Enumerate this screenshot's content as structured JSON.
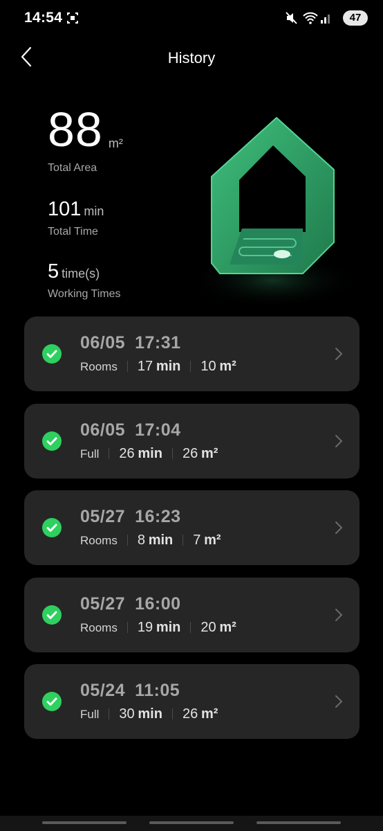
{
  "status_bar": {
    "time": "14:54",
    "battery": "47"
  },
  "header": {
    "title": "History"
  },
  "summary": {
    "total_area": {
      "value": "88",
      "unit": "m²",
      "label": "Total Area"
    },
    "total_time": {
      "value": "101",
      "unit": "min",
      "label": "Total Time"
    },
    "working_times": {
      "value": "5",
      "unit": "time(s)",
      "label": "Working Times"
    }
  },
  "records": [
    {
      "date": "06/05",
      "time": "17:31",
      "mode": "Rooms",
      "duration": "17",
      "duration_unit": "min",
      "area": "10",
      "area_unit": "m²"
    },
    {
      "date": "06/05",
      "time": "17:04",
      "mode": "Full",
      "duration": "26",
      "duration_unit": "min",
      "area": "26",
      "area_unit": "m²"
    },
    {
      "date": "05/27",
      "time": "16:23",
      "mode": "Rooms",
      "duration": "8",
      "duration_unit": "min",
      "area": "7",
      "area_unit": "m²"
    },
    {
      "date": "05/27",
      "time": "16:00",
      "mode": "Rooms",
      "duration": "19",
      "duration_unit": "min",
      "area": "20",
      "area_unit": "m²"
    },
    {
      "date": "05/24",
      "time": "11:05",
      "mode": "Full",
      "duration": "30",
      "duration_unit": "min",
      "area": "26",
      "area_unit": "m²"
    }
  ],
  "colors": {
    "background": "#000000",
    "card": "#262626",
    "success": "#2ed05f",
    "house_accent": "#2b9a5f"
  }
}
